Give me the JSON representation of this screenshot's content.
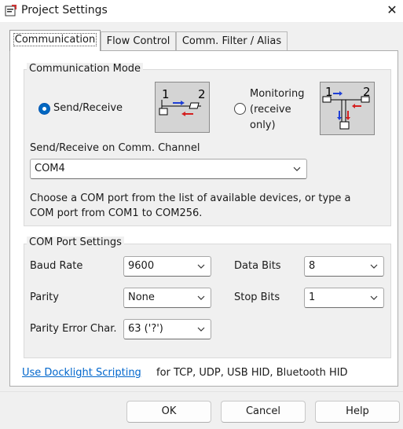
{
  "window": {
    "title": "Project Settings"
  },
  "tabs": [
    {
      "label": "Communication"
    },
    {
      "label": "Flow Control"
    },
    {
      "label": "Comm. Filter / Alias"
    }
  ],
  "communication_mode": {
    "title": "Communication Mode",
    "send_receive_label": "Send/Receive",
    "send_receive_selected": true,
    "monitoring_label_line1": "Monitoring",
    "monitoring_label_line2": "(receive",
    "monitoring_label_line3": "only)",
    "monitoring_selected": false,
    "diagram_left_numbers": [
      "1",
      "2"
    ],
    "diagram_right_numbers": [
      "1",
      "2"
    ],
    "channel_label": "Send/Receive on Comm. Channel",
    "channel_value": "COM4",
    "help_line1": "Choose a COM port from the list of available devices, or type a",
    "help_line2": "COM port from COM1 to COM256."
  },
  "com_port": {
    "title": "COM Port Settings",
    "baud_rate_label": "Baud Rate",
    "baud_rate_value": "9600",
    "data_bits_label": "Data Bits",
    "data_bits_value": "8",
    "parity_label": "Parity",
    "parity_value": "None",
    "stop_bits_label": "Stop Bits",
    "stop_bits_value": "1",
    "parity_error_label": "Parity Error Char.",
    "parity_error_value": "63 ('?')"
  },
  "scripting": {
    "link_text": "Use Docklight Scripting",
    "suffix_text": "for TCP, UDP, USB HID, Bluetooth HID"
  },
  "buttons": {
    "ok": "OK",
    "cancel": "Cancel",
    "help": "Help"
  },
  "colors": {
    "accent": "#0067c0",
    "link": "#0066cc",
    "arrow_blue": "#1f3fd6",
    "arrow_red": "#d42020"
  }
}
